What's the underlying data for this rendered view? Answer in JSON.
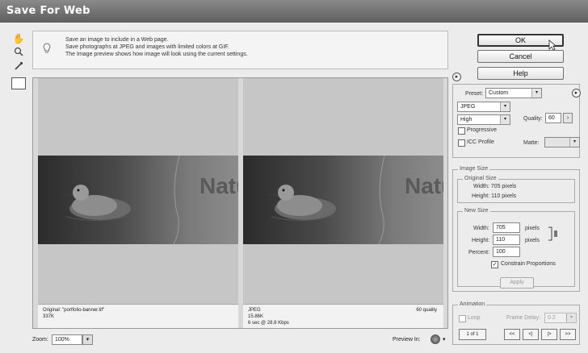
{
  "window": {
    "title": "Save For Web"
  },
  "tools": [
    {
      "name": "hand-tool-icon",
      "glyph": "✋"
    },
    {
      "name": "zoom-tool-icon",
      "glyph": "🔍"
    },
    {
      "name": "eyedropper-tool-icon",
      "glyph": "⁄"
    }
  ],
  "info": {
    "lines": [
      "Save an image to include in a Web page.",
      "Save photographs at JPEG and images with limited colors at GIF.",
      "The Image preview shows how image will look using the current settings."
    ]
  },
  "preview": {
    "word": "Natu",
    "original": {
      "line1": "Original: \"portfolio-banner.tif\"",
      "line2": "337K"
    },
    "optimized": {
      "line1": "JPEG",
      "line2": "15.86K",
      "line3": "6 sec @ 28.8 Kbps",
      "quality": "60 quality"
    }
  },
  "statusbar": {
    "zoom_label": "Zoom:",
    "zoom_value": "100%",
    "preview_label": "Preview In:"
  },
  "buttons": {
    "ok": "OK",
    "cancel": "Cancel",
    "help": "Help"
  },
  "settings": {
    "preset_label": "Preset:",
    "preset_value": "Custom",
    "format": "JPEG",
    "quality_level": "High",
    "quality_label": "Quality:",
    "quality_value": "60",
    "progressive_label": "Progressive",
    "progressive_checked": false,
    "icc_label": "ICC Profile",
    "icc_checked": false,
    "matte_label": "Matte:"
  },
  "image_size": {
    "section_label": "Image Size",
    "original_label": "Original Size",
    "orig_width": "Width: 705 pixels",
    "orig_height": "Height: 110 pixels",
    "new_label": "New Size",
    "width_label": "Width:",
    "width_value": "705",
    "height_label": "Height:",
    "height_value": "110",
    "pixels_unit": "pixels",
    "percent_label": "Percent:",
    "percent_value": "100",
    "constrain_label": "Constrain Proportions",
    "constrain_checked": true,
    "apply_label": "Apply"
  },
  "animation": {
    "section_label": "Animation",
    "loop_label": "Loop",
    "frame_delay_label": "Frame Delay:",
    "frame_delay_value": "0.2",
    "frame_counter": "1 of 1",
    "controls": [
      "<<",
      "<|",
      "|>",
      ">>"
    ]
  }
}
